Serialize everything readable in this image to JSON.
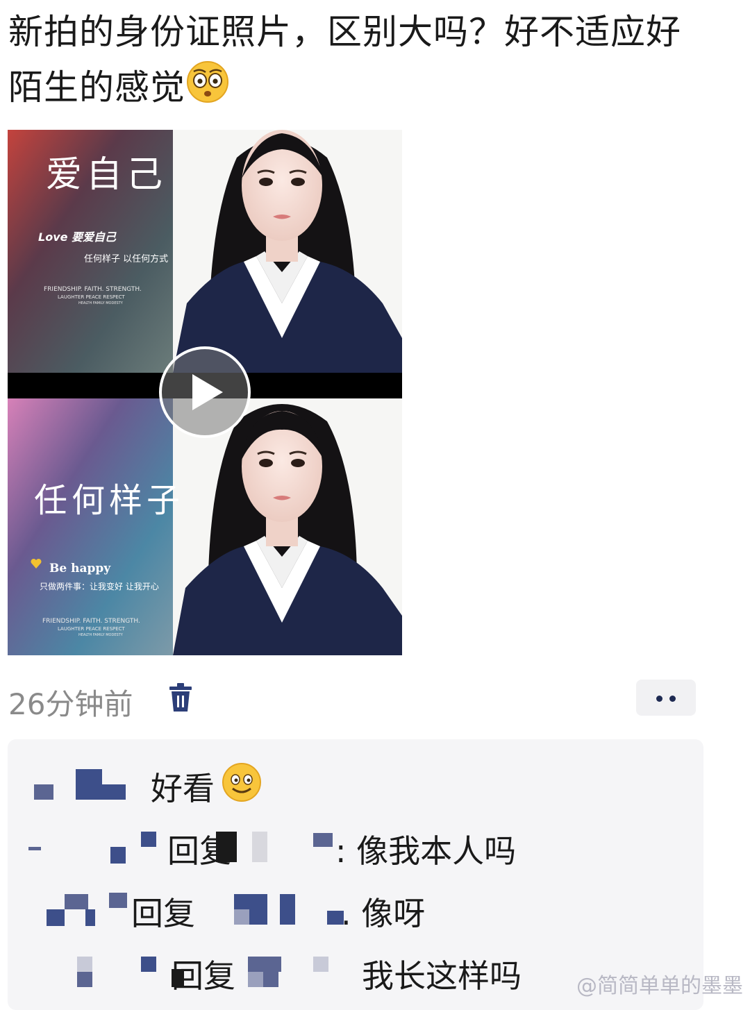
{
  "post": {
    "text": "新拍的身份证照片，区别大吗？好不适应好陌生的感觉",
    "emoji": "flushed-face"
  },
  "media": {
    "top_panel": {
      "title": "爱自己",
      "love_line": "Love 要爱自己",
      "sub_line": "任何样子 以任何方式",
      "eng_line1": "FRIENDSHIP. FAITH. STRENGTH.",
      "eng_line2": "LAUGHTER PEACE RESPECT",
      "eng_line3": "HEALTH FAMILY MODESTY"
    },
    "bottom_panel": {
      "title": "任何样子",
      "happy_line": "Be happy",
      "sub_line": "只做两件事：让我变好 让我开心",
      "eng_line1": "FRIENDSHIP. FAITH. STRENGTH.",
      "eng_line2": "LAUGHTER PEACE RESPECT",
      "eng_line3": "HEALTH FAMILY MODESTY"
    },
    "play_icon": "play-icon"
  },
  "meta": {
    "time": "26分钟前",
    "delete_icon": "trash-icon",
    "more_icon": "more-icon"
  },
  "comments": [
    {
      "text": "好看",
      "emoji": "smiling-face"
    },
    {
      "reply_label": "回复",
      "text": ": 像我本人吗"
    },
    {
      "reply_label": "回复",
      "text": ". 像呀"
    },
    {
      "reply_label": "回复",
      "text": "我长这样吗"
    }
  ],
  "watermark": "@简简单单的墨墨"
}
